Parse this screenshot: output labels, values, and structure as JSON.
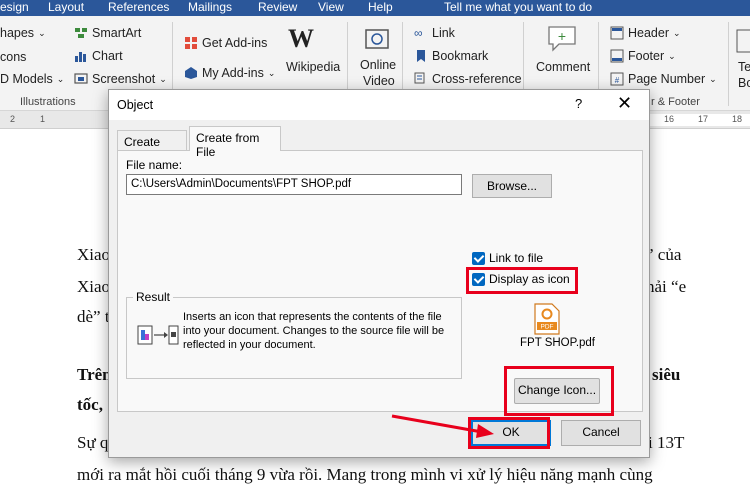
{
  "ribbon": {
    "tabs": [
      "esign",
      "Layout",
      "References",
      "Mailings",
      "Review",
      "View",
      "Help",
      "Tell me what you want to do"
    ],
    "illustrations": {
      "shapes": "hapes",
      "icons": "cons",
      "models": "D Models",
      "smartart": "SmartArt",
      "chart": "Chart",
      "screenshot": "Screenshot",
      "group_label": "Illustrations"
    },
    "addins": {
      "get_addins": "Get Add-ins",
      "my_addins": "My Add-ins",
      "wikipedia": "Wikipedia"
    },
    "media": {
      "online_video_1": "Online",
      "online_video_2": "Video"
    },
    "links": {
      "link": "Link",
      "bookmark": "Bookmark",
      "cross_reference": "Cross-reference"
    },
    "comments": {
      "comment": "Comment"
    },
    "header_footer": {
      "header": "Header",
      "footer": "Footer",
      "page_number": "Page Number",
      "group_label": "r & Footer"
    },
    "text": {
      "t1": "Te",
      "t2": "Bo"
    }
  },
  "ruler": {
    "marks": [
      "2",
      "1",
      "16",
      "17",
      "18"
    ]
  },
  "document": {
    "lines": [
      {
        "left": "Xiao",
        "right": "” của"
      },
      {
        "left": "Xiao",
        "right": "hải “e"
      },
      {
        "left": "dè” t",
        "right": ""
      },
      {
        "left": "Trên",
        "right": "siêu"
      },
      {
        "left": "tốc,",
        "right": ""
      },
      {
        "left": "Sự q",
        "right": "i 13T"
      }
    ],
    "full_line_1": "mới ra mắt hồi cuối tháng 9 vừa rồi. Mang trong mình vi xử lý hiệu năng mạnh cùng"
  },
  "dialog": {
    "title": "Object",
    "help": "?",
    "close": "✕",
    "tabs": [
      "Create New",
      "Create from File"
    ],
    "file_name_label": "File name:",
    "file_name_value": "C:\\Users\\Admin\\Documents\\FPT SHOP.pdf",
    "browse_label": "Browse...",
    "link_to_file": "Link to file",
    "display_as_icon": "Display as icon",
    "result_label": "Result",
    "result_text": "Inserts an icon that represents the contents of the file into your document.  Changes to the source file will be reflected in your document.",
    "icon_caption": "FPT SHOP.pdf",
    "pdf_badge": "PDF",
    "change_icon_label": "Change Icon...",
    "ok_label": "OK",
    "cancel_label": "Cancel"
  },
  "colors": {
    "accent": "#0067c0",
    "highlight": "#e8001c",
    "ribbon_tab": "#2b579a"
  }
}
